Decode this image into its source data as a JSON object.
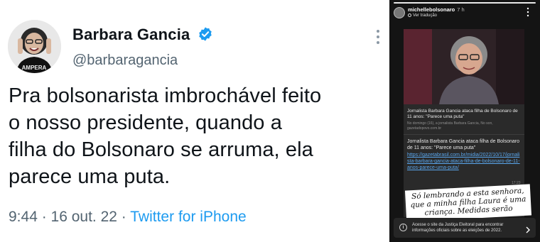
{
  "tweet": {
    "display_name": "Barbara Gancia",
    "handle": "@barbaragancia",
    "text_lines": [
      "Pra bolsonarista imbrochável feito",
      "o nosso presidente, quando a",
      "filha do Bolsonaro se arruma, ela",
      "parece uma puta."
    ],
    "time": "9:44",
    "date": "16 out. 22",
    "source": "Twitter for iPhone",
    "separator": " · ",
    "avatar_shirt_text": "AMPERA",
    "accent": "#1d9bf0",
    "text_color": "#0f1419",
    "muted_color": "#536471"
  },
  "story": {
    "username": "michellebolsonaro",
    "time": "7 h",
    "translate_label": "Ver tradução",
    "card": {
      "title": "Jornalista Barbara Gancia ataca filha de Bolsonaro de 11 anos: \"Parece uma puta\"",
      "subtitle": "No domingo (16), a jornalista Barbara Gancia, No son,",
      "domain": "gazetadopovo.com.br",
      "body": "Jornalista Barbara Gancia ataca filha de Bolsonaro de 11 anos: \"Parece uma puta\"",
      "link": "https://gazetabrasil.com.br/midia/2022/10/17/jornalista-barbara-gancia-ataca-filha-de-bolsonaro-de-11-anos-parece-uma-puta/",
      "link_time": "17:23"
    },
    "sticker_text": "Só lembrando a esta senhora, que a minha filha Laura é uma criança. Medidas serão",
    "bottom_bar_text": "Acesse o site da Justiça Eleitoral para encontrar informações oficiais sobre as eleições de 2022.",
    "link_color": "#5aa7ee"
  }
}
